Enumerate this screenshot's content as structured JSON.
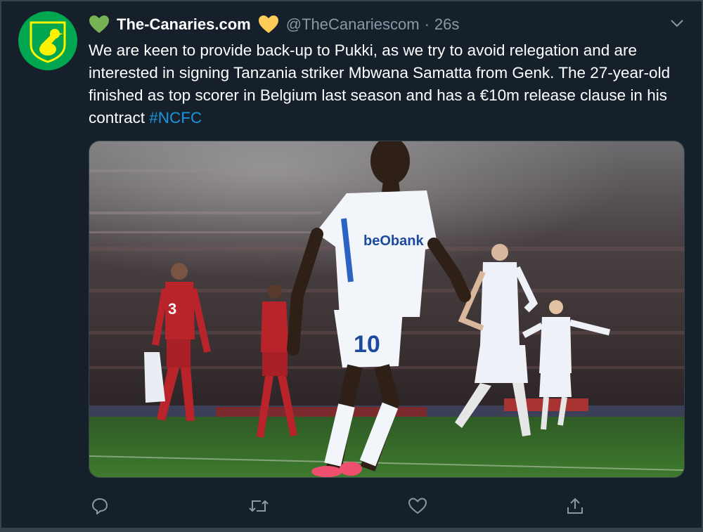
{
  "tweet": {
    "display_name": "The-Canaries.com",
    "handle": "@TheCanariescom",
    "separator": "·",
    "time": "26s",
    "text": "We are keen to provide back-up to Pukki, as we try to avoid relegation and are interested in signing Tanzania striker Mbwana Samatta from Genk. The 27-year-old finished as top scorer in Belgium last season and has a €10m release clause in his contract ",
    "hashtag": "#NCFC",
    "name_emoji_left": "green-heart-icon",
    "name_emoji_right": "yellow-heart-icon",
    "photo": {
      "sponsor": "beObank",
      "shirt_number": "10",
      "opponent_number": "3"
    }
  },
  "actions": [
    "reply-icon",
    "retweet-icon",
    "like-icon",
    "share-icon"
  ],
  "colors": {
    "background": "#15202b",
    "secondary_text": "#8899a6",
    "hashtag": "#1b95e0",
    "avatar_bg": "#00a650",
    "avatar_bird": "#fff200"
  }
}
